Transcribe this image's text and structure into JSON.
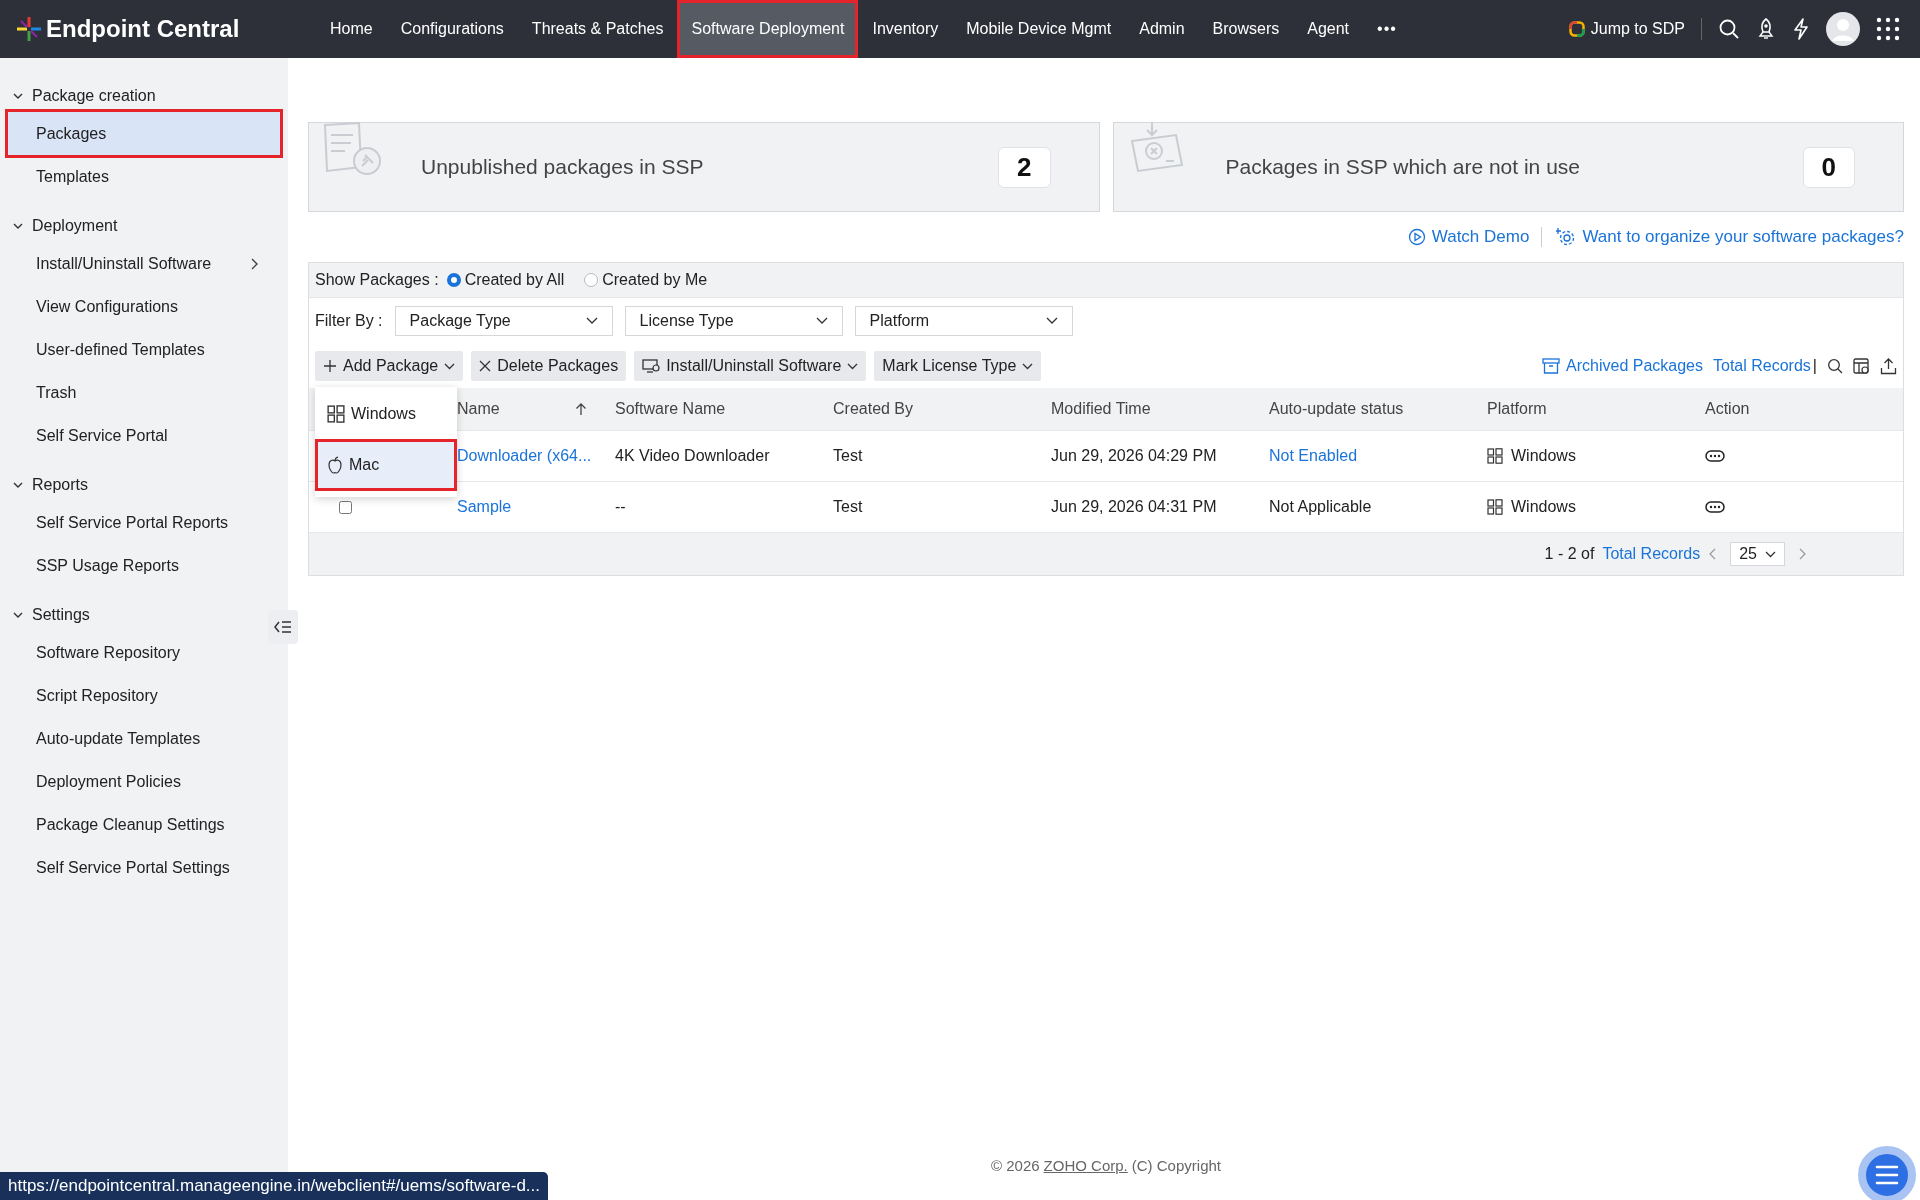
{
  "topbar": {
    "logo": "Endpoint Central",
    "nav": [
      {
        "label": "Home",
        "selected": false,
        "highlighted": false
      },
      {
        "label": "Configurations",
        "selected": false,
        "highlighted": false
      },
      {
        "label": "Threats & Patches",
        "selected": false,
        "highlighted": false
      },
      {
        "label": "Software Deployment",
        "selected": true,
        "highlighted": true
      },
      {
        "label": "Inventory",
        "selected": false,
        "highlighted": false
      },
      {
        "label": "Mobile Device Mgmt",
        "selected": false,
        "highlighted": false
      },
      {
        "label": "Admin",
        "selected": false,
        "highlighted": false
      },
      {
        "label": "Browsers",
        "selected": false,
        "highlighted": false
      },
      {
        "label": "Agent",
        "selected": false,
        "highlighted": false
      }
    ],
    "more": "•••",
    "jump": "Jump to SDP"
  },
  "sidebar": {
    "groups": [
      {
        "title": "Package creation",
        "expanded": true,
        "items": [
          {
            "label": "Packages",
            "selected": true,
            "highlighted": true,
            "submenu": false
          },
          {
            "label": "Templates",
            "selected": false,
            "highlighted": false,
            "submenu": false
          }
        ]
      },
      {
        "title": "Deployment",
        "expanded": true,
        "items": [
          {
            "label": "Install/Uninstall Software",
            "selected": false,
            "highlighted": false,
            "submenu": true
          },
          {
            "label": "View Configurations",
            "selected": false,
            "highlighted": false,
            "submenu": false
          },
          {
            "label": "User-defined Templates",
            "selected": false,
            "highlighted": false,
            "submenu": false
          },
          {
            "label": "Trash",
            "selected": false,
            "highlighted": false,
            "submenu": false
          },
          {
            "label": "Self Service Portal",
            "selected": false,
            "highlighted": false,
            "submenu": false
          }
        ]
      },
      {
        "title": "Reports",
        "expanded": true,
        "items": [
          {
            "label": "Self Service Portal Reports",
            "selected": false,
            "highlighted": false,
            "submenu": false
          },
          {
            "label": "SSP Usage Reports",
            "selected": false,
            "highlighted": false,
            "submenu": false
          }
        ]
      },
      {
        "title": "Settings",
        "expanded": true,
        "items": [
          {
            "label": "Software Repository",
            "selected": false,
            "highlighted": false,
            "submenu": false
          },
          {
            "label": "Script Repository",
            "selected": false,
            "highlighted": false,
            "submenu": false
          },
          {
            "label": "Auto-update Templates",
            "selected": false,
            "highlighted": false,
            "submenu": false
          },
          {
            "label": "Deployment Policies",
            "selected": false,
            "highlighted": false,
            "submenu": false
          },
          {
            "label": "Package Cleanup Settings",
            "selected": false,
            "highlighted": false,
            "submenu": false
          },
          {
            "label": "Self Service Portal Settings",
            "selected": false,
            "highlighted": false,
            "submenu": false
          }
        ]
      }
    ]
  },
  "summary_cards": [
    {
      "kind": "unpublished",
      "label": "Unpublished packages in SSP",
      "count": "2"
    },
    {
      "kind": "unused",
      "label": "Packages in SSP which are not in use",
      "count": "0"
    }
  ],
  "links": {
    "watch_demo": "Watch Demo",
    "organize": "Want to organize your software packages?"
  },
  "show_packages": {
    "label": "Show Packages :",
    "options": [
      {
        "label": "Created by All",
        "selected": true
      },
      {
        "label": "Created by Me",
        "selected": false
      }
    ]
  },
  "filter": {
    "label": "Filter By :",
    "dropdowns": [
      "Package Type",
      "License Type",
      "Platform"
    ]
  },
  "toolbar": {
    "actions": [
      {
        "kind": "add",
        "label": "Add Package"
      },
      {
        "kind": "delete",
        "label": "Delete Packages"
      },
      {
        "kind": "install",
        "label": "Install/Uninstall Software"
      },
      {
        "kind": "license",
        "label": "Mark License Type"
      }
    ],
    "archived": "Archived Packages",
    "total_records": "Total Records",
    "separator": "|"
  },
  "add_package_menu": {
    "items": [
      {
        "kind": "windows",
        "label": "Windows",
        "highlighted": false
      },
      {
        "kind": "mac",
        "label": "Mac",
        "highlighted": true
      }
    ]
  },
  "table": {
    "columns": [
      {
        "label": "Name",
        "sorted": true
      },
      {
        "label": "Software Name",
        "sorted": false
      },
      {
        "label": "Created By",
        "sorted": false
      },
      {
        "label": "Modified Time",
        "sorted": false
      },
      {
        "label": "Auto-update status",
        "sorted": false
      },
      {
        "label": "Platform",
        "sorted": false
      },
      {
        "label": "Action",
        "sorted": false
      }
    ],
    "rows": [
      {
        "name": "Downloader (x64...",
        "software": "4K Video Downloader",
        "created_by": "Test",
        "modified": "Jun 29, 2026 04:29 PM",
        "auto_update": "Not Enabled",
        "auto_update_link": true,
        "platform": "Windows"
      },
      {
        "checked": false,
        "name": "Sample",
        "software": "--",
        "created_by": "Test",
        "modified": "Jun 29, 2026 04:31 PM",
        "auto_update": "Not Applicable",
        "auto_update_link": false,
        "platform": "Windows"
      }
    ],
    "pagination": {
      "range": "1 - 2 of",
      "total": "Total Records",
      "page_size": "25"
    }
  },
  "footer": {
    "year": "© 2026",
    "company": "ZOHO Corp.",
    "copyright": "(C) Copyright"
  },
  "status_bar": {
    "url": "https://endpointcentral.manageengine.in/webclient#/uems/software-d..."
  }
}
